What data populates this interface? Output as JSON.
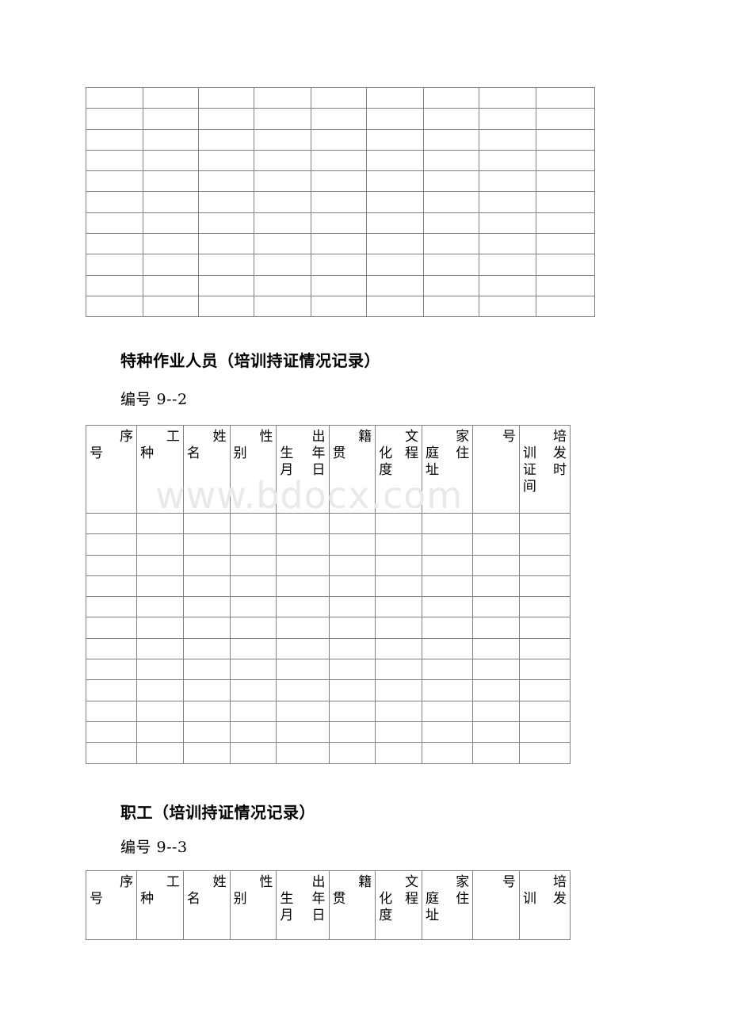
{
  "watermark": "www.bdocx.com",
  "sections": [
    {
      "id": "blank-table",
      "title": null,
      "code": null,
      "table": {
        "columns": 9,
        "rows": 11,
        "headers": null
      }
    },
    {
      "id": "special-operations",
      "title": "特种作业人员（培训持证情况记录）",
      "code": "编号 9--2",
      "table": {
        "columns": 10,
        "data_rows": 12,
        "headers": [
          {
            "name": "序号",
            "lines": [
              {
                "align": "right",
                "text": "序"
              },
              {
                "align": "left",
                "text": "号"
              }
            ]
          },
          {
            "name": "工种",
            "lines": [
              {
                "align": "right",
                "text": "工"
              },
              {
                "align": "left",
                "text": "种"
              }
            ]
          },
          {
            "name": "姓名",
            "lines": [
              {
                "align": "right",
                "text": "姓"
              },
              {
                "align": "left",
                "text": "名"
              }
            ]
          },
          {
            "name": "性别",
            "lines": [
              {
                "align": "right",
                "text": "性"
              },
              {
                "align": "left",
                "text": "别"
              }
            ]
          },
          {
            "name": "出生年月日",
            "lines": [
              {
                "align": "right",
                "text": "出"
              },
              {
                "align": "justify",
                "text": "生年"
              },
              {
                "align": "justify",
                "text": "月日"
              }
            ]
          },
          {
            "name": "籍贯",
            "lines": [
              {
                "align": "right",
                "text": "籍"
              },
              {
                "align": "left",
                "text": "贯"
              }
            ]
          },
          {
            "name": "文化程度",
            "lines": [
              {
                "align": "right",
                "text": "文"
              },
              {
                "align": "justify",
                "text": "化程"
              },
              {
                "align": "left",
                "text": "度"
              }
            ]
          },
          {
            "name": "家庭住址",
            "lines": [
              {
                "align": "right",
                "text": "家"
              },
              {
                "align": "justify",
                "text": "庭住"
              },
              {
                "align": "left",
                "text": "址"
              }
            ]
          },
          {
            "name": "号",
            "lines": [
              {
                "align": "right",
                "text": "号"
              }
            ]
          },
          {
            "name": "培训发证时间",
            "lines": [
              {
                "align": "right",
                "text": "培"
              },
              {
                "align": "justify",
                "text": "训发"
              },
              {
                "align": "justify",
                "text": "证时"
              },
              {
                "align": "left",
                "text": "间"
              }
            ]
          }
        ]
      }
    },
    {
      "id": "staff",
      "title": "职工（培训持证情况记录）",
      "code": "编号 9--3",
      "table": {
        "columns": 10,
        "data_rows": 0,
        "headers": [
          {
            "name": "序号",
            "lines": [
              {
                "align": "right",
                "text": "序"
              },
              {
                "align": "left",
                "text": "号"
              }
            ]
          },
          {
            "name": "工种",
            "lines": [
              {
                "align": "right",
                "text": "工"
              },
              {
                "align": "left",
                "text": "种"
              }
            ]
          },
          {
            "name": "姓名",
            "lines": [
              {
                "align": "right",
                "text": "姓"
              },
              {
                "align": "left",
                "text": "名"
              }
            ]
          },
          {
            "name": "性别",
            "lines": [
              {
                "align": "right",
                "text": "性"
              },
              {
                "align": "left",
                "text": "别"
              }
            ]
          },
          {
            "name": "出生年月日",
            "lines": [
              {
                "align": "right",
                "text": "出"
              },
              {
                "align": "justify",
                "text": "生年"
              },
              {
                "align": "justify",
                "text": "月日"
              }
            ]
          },
          {
            "name": "籍贯",
            "lines": [
              {
                "align": "right",
                "text": "籍"
              },
              {
                "align": "left",
                "text": "贯"
              }
            ]
          },
          {
            "name": "文化程度",
            "lines": [
              {
                "align": "right",
                "text": "文"
              },
              {
                "align": "justify",
                "text": "化程"
              },
              {
                "align": "left",
                "text": "度"
              }
            ]
          },
          {
            "name": "家庭住址",
            "lines": [
              {
                "align": "right",
                "text": "家"
              },
              {
                "align": "justify",
                "text": "庭住"
              },
              {
                "align": "left",
                "text": "址"
              }
            ]
          },
          {
            "name": "号",
            "lines": [
              {
                "align": "right",
                "text": "号"
              }
            ]
          },
          {
            "name": "培训发",
            "lines": [
              {
                "align": "right",
                "text": "培"
              },
              {
                "align": "justify",
                "text": "训发"
              }
            ]
          }
        ]
      }
    }
  ],
  "layout": {
    "table_columns_blank": [
      72,
      70,
      70,
      72,
      70,
      72,
      70,
      72,
      74
    ],
    "table_columns_record": [
      60,
      55,
      55,
      55,
      62,
      55,
      55,
      60,
      55,
      60
    ]
  }
}
